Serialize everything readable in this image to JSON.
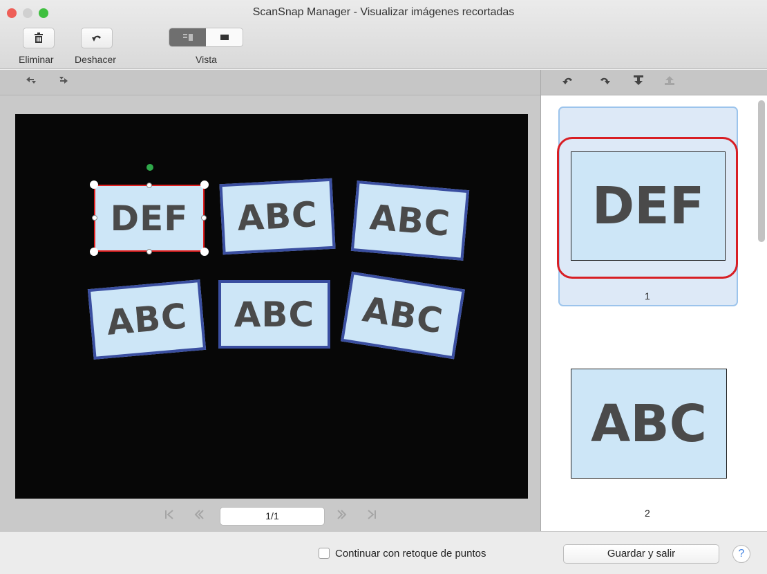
{
  "window": {
    "title": "ScanSnap Manager - Visualizar imágenes recortadas",
    "traffic_lights": {
      "close": "#ee5e57",
      "minimize": "#d0d0d0",
      "zoom": "#3fbf3f"
    }
  },
  "toolbar": {
    "delete_label": "Eliminar",
    "delete_icon": "trash-icon",
    "undo_label": "Deshacer",
    "undo_icon": "undo-icon",
    "view_label": "Vista",
    "view_options": [
      "split-view-icon",
      "single-view-icon"
    ]
  },
  "left_tools": {
    "icons": [
      "rotate-left-icon",
      "rotate-right-icon"
    ]
  },
  "right_tools": {
    "icons": [
      "rotate-ccw-icon",
      "rotate-cw-icon",
      "merge-down-icon",
      "merge-up-icon"
    ]
  },
  "canvas": {
    "cards": [
      {
        "text": "DEF",
        "selected": true
      },
      {
        "text": "ABC"
      },
      {
        "text": "ABC"
      },
      {
        "text": "ABC"
      },
      {
        "text": "ABC"
      },
      {
        "text": "ABC"
      }
    ]
  },
  "pager": {
    "value": "1/1"
  },
  "thumbnails": [
    {
      "text": "DEF",
      "number": "1",
      "selected": true
    },
    {
      "text": "ABC",
      "number": "2"
    }
  ],
  "footer": {
    "checkbox_label": "Continuar con retoque de puntos",
    "checkbox_checked": false,
    "save_button": "Guardar y salir",
    "help": "?"
  },
  "colors": {
    "selection_red": "#e02020",
    "card_border": "#3a4ea0",
    "card_fill": "#cde6f7",
    "highlight_red": "#d81e24"
  }
}
